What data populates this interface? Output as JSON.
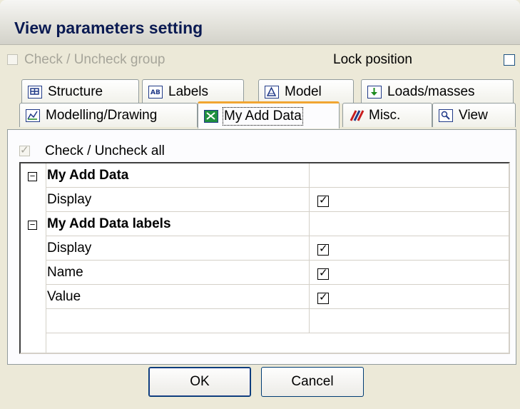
{
  "window": {
    "title": "View parameters setting"
  },
  "header": {
    "check_group_label": "Check / Uncheck group",
    "lock_position_label": "Lock position"
  },
  "tabs": {
    "row1": [
      {
        "label": "Structure",
        "icon": "structure-icon"
      },
      {
        "label": "Labels",
        "icon": "labels-icon"
      },
      {
        "label": "Model",
        "icon": "model-icon"
      },
      {
        "label": "Loads/masses",
        "icon": "loads-icon"
      }
    ],
    "row2": [
      {
        "label": "Modelling/Drawing",
        "icon": "modelling-icon"
      },
      {
        "label": "My Add Data",
        "icon": "add-data-icon",
        "active": true
      },
      {
        "label": "Misc.",
        "icon": "misc-icon"
      },
      {
        "label": "View",
        "icon": "view-icon"
      }
    ]
  },
  "panel": {
    "check_all_label": "Check / Uncheck all",
    "check_all_checked": true,
    "rows": [
      {
        "name": "My Add Data",
        "type": "group",
        "expander": "−"
      },
      {
        "name": "Display",
        "type": "item",
        "checked": true
      },
      {
        "name": "My Add Data labels",
        "type": "group",
        "expander": "−"
      },
      {
        "name": "Display",
        "type": "item",
        "checked": true
      },
      {
        "name": "Name",
        "type": "item",
        "checked": true
      },
      {
        "name": "Value",
        "type": "item",
        "checked": true
      },
      {
        "name": "",
        "type": "empty"
      }
    ]
  },
  "buttons": {
    "ok": "OK",
    "cancel": "Cancel"
  },
  "colors": {
    "title": "#0a1a52",
    "active_tab_accent": "#f1a532",
    "face": "#ece9d8"
  }
}
